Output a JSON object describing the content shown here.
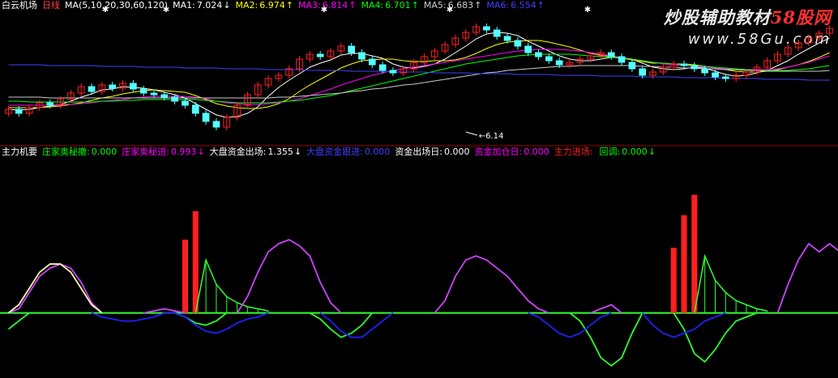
{
  "top_bar": {
    "stock_name": "白云机场",
    "period": "日线",
    "ma_params": "MA(5,10,20,30,60,120)",
    "items": [
      {
        "label": "MA1:",
        "value": "7.024",
        "arrow": "↓",
        "color": "#ffffff"
      },
      {
        "label": "MA2:",
        "value": "6.974",
        "arrow": "↑",
        "color": "#ffff00"
      },
      {
        "label": "MA3:",
        "value": "6.814",
        "arrow": "↑",
        "color": "#ff00ff"
      },
      {
        "label": "MA4:",
        "value": "6.701",
        "arrow": "↑",
        "color": "#00ff00"
      },
      {
        "label": "MA5:",
        "value": "6.683",
        "arrow": "↑",
        "color": "#cccccc"
      },
      {
        "label": "MA6:",
        "value": "6.554",
        "arrow": "↑",
        "color": "#4040ff"
      }
    ]
  },
  "watermark": {
    "line1_main": "炒股辅助教材",
    "line1_accent": "58股网",
    "line2": "www.58Gu.com"
  },
  "low_annotation": "6.14",
  "indicator_bar": {
    "title": "主力机要",
    "items": [
      {
        "label": "庄家奥秘撤:",
        "value": "0.000",
        "arrow": "",
        "color": "#00ff00"
      },
      {
        "label": "庄家奥秘进:",
        "value": "0.993",
        "arrow": "↓",
        "color": "#ff00ff"
      },
      {
        "label": "大盘资金出场:",
        "value": "1.355",
        "arrow": "↓",
        "color": "#ffffff"
      },
      {
        "label": "大盘资金跟进:",
        "value": "0.000",
        "arrow": "",
        "color": "#4040ff"
      },
      {
        "label": "资金出场日:",
        "value": "0.000",
        "arrow": "",
        "color": "#ffffff"
      },
      {
        "label": "资金加仓日:",
        "value": "0.000",
        "arrow": "",
        "color": "#ff00ff"
      },
      {
        "label": "主力进场:",
        "value": "",
        "arrow": "",
        "color": "#ff2020"
      },
      {
        "label": "回调:",
        "value": "0.000",
        "arrow": "↓",
        "color": "#00ff00"
      }
    ]
  },
  "chart_data": [
    {
      "type": "candlestick",
      "panel": "price",
      "up_color": "#ff2020",
      "down_color": "#54ffff",
      "low_marker": {
        "index": 44,
        "value": 6.14
      },
      "closes": [
        6.4,
        6.35,
        6.42,
        6.48,
        6.45,
        6.52,
        6.6,
        6.68,
        6.62,
        6.7,
        6.66,
        6.72,
        6.65,
        6.6,
        6.58,
        6.55,
        6.5,
        6.45,
        6.35,
        6.25,
        6.18,
        6.3,
        6.45,
        6.58,
        6.7,
        6.78,
        6.82,
        6.9,
        7.02,
        7.08,
        7.05,
        7.12,
        7.18,
        7.1,
        7.02,
        6.95,
        6.88,
        6.85,
        6.9,
        6.98,
        7.05,
        7.12,
        7.2,
        7.28,
        7.35,
        7.42,
        7.38,
        7.3,
        7.25,
        7.18,
        7.1,
        7.05,
        7.0,
        6.95,
        6.98,
        7.02,
        7.06,
        7.1,
        7.05,
        6.98,
        6.9,
        6.82,
        6.86,
        6.92,
        6.96,
        6.94,
        6.9,
        6.85,
        6.8,
        6.78,
        6.82,
        6.86,
        6.92,
        7.0,
        7.08,
        7.16,
        7.22,
        7.28,
        7.34,
        7.4
      ],
      "ma_lines": [
        {
          "name": "MA1",
          "color": "#ffffff",
          "values": [
            6.4,
            6.39,
            6.4,
            6.42,
            6.44,
            6.46,
            6.5,
            6.55,
            6.59,
            6.64,
            6.65,
            6.68,
            6.67,
            6.66,
            6.64,
            6.61,
            6.58,
            6.54,
            6.47,
            6.4,
            6.33,
            6.3,
            6.31,
            6.35,
            6.43,
            6.56,
            6.67,
            6.76,
            6.84,
            6.92,
            6.97,
            7.01,
            7.07,
            7.09,
            7.09,
            7.06,
            7.03,
            6.96,
            6.92,
            6.91,
            6.93,
            6.96,
            7.02,
            7.1,
            7.18,
            7.27,
            7.33,
            7.35,
            7.34,
            7.31,
            7.24,
            7.18,
            7.12,
            7.06,
            7.02,
            7.0,
            7.0,
            7.02,
            7.04,
            7.04,
            7.02,
            6.97,
            6.92,
            6.9,
            6.89,
            6.9,
            6.92,
            6.91,
            6.87,
            6.83,
            6.81,
            6.82,
            6.85,
            6.88,
            6.94,
            7.0,
            7.08,
            7.15,
            7.22,
            7.28
          ]
        },
        {
          "name": "MA2",
          "color": "#ffff00",
          "values": [
            6.42,
            6.42,
            6.42,
            6.42,
            6.43,
            6.44,
            6.46,
            6.48,
            6.51,
            6.54,
            6.56,
            6.59,
            6.61,
            6.63,
            6.64,
            6.63,
            6.62,
            6.61,
            6.57,
            6.52,
            6.47,
            6.44,
            6.42,
            6.41,
            6.41,
            6.43,
            6.47,
            6.53,
            6.62,
            6.7,
            6.77,
            6.84,
            6.91,
            6.96,
            7.0,
            7.01,
            7.02,
            7.02,
            7.0,
            6.99,
            6.99,
            7.0,
            7.0,
            7.01,
            7.04,
            7.09,
            7.15,
            7.2,
            7.23,
            7.24,
            7.25,
            7.25,
            7.23,
            7.2,
            7.17,
            7.13,
            7.09,
            7.07,
            7.05,
            7.03,
            7.01,
            6.99,
            6.97,
            6.97,
            6.96,
            6.96,
            6.95,
            6.93,
            6.91,
            6.89,
            6.87,
            6.86,
            6.86,
            6.87,
            6.89,
            6.92,
            6.95,
            6.99,
            7.04,
            7.1
          ]
        },
        {
          "name": "MA3",
          "color": "#ff00ff",
          "values": [
            6.45,
            6.45,
            6.45,
            6.45,
            6.45,
            6.46,
            6.46,
            6.47,
            6.48,
            6.5,
            6.51,
            6.52,
            6.54,
            6.55,
            6.56,
            6.56,
            6.56,
            6.56,
            6.55,
            6.53,
            6.5,
            6.48,
            6.47,
            6.46,
            6.46,
            6.47,
            6.48,
            6.5,
            6.53,
            6.57,
            6.61,
            6.65,
            6.7,
            6.74,
            6.78,
            6.82,
            6.85,
            6.88,
            6.9,
            6.92,
            6.94,
            6.96,
            6.98,
            7.0,
            7.02,
            7.04,
            7.06,
            7.08,
            7.1,
            7.12,
            7.13,
            7.14,
            7.14,
            7.14,
            7.13,
            7.12,
            7.1,
            7.08,
            7.06,
            7.04,
            7.02,
            7.0,
            6.98,
            6.96,
            6.95,
            6.94,
            6.93,
            6.92,
            6.91,
            6.9,
            6.89,
            6.89,
            6.89,
            6.89,
            6.9,
            6.92,
            6.95,
            6.98,
            7.02,
            7.06
          ]
        },
        {
          "name": "MA4",
          "color": "#00ff00",
          "values": [
            6.5,
            6.5,
            6.49,
            6.49,
            6.49,
            6.49,
            6.49,
            6.49,
            6.49,
            6.5,
            6.5,
            6.51,
            6.51,
            6.52,
            6.52,
            6.52,
            6.52,
            6.52,
            6.52,
            6.51,
            6.5,
            6.49,
            6.48,
            6.48,
            6.48,
            6.48,
            6.49,
            6.5,
            6.51,
            6.53,
            6.55,
            6.57,
            6.6,
            6.63,
            6.66,
            6.69,
            6.72,
            6.75,
            6.78,
            6.81,
            6.84,
            6.87,
            6.9,
            6.93,
            6.96,
            6.98,
            7.0,
            7.02,
            7.04,
            7.06,
            7.07,
            7.08,
            7.08,
            7.08,
            7.08,
            7.07,
            7.06,
            7.05,
            7.04,
            7.03,
            7.02,
            7.0,
            6.98,
            6.97,
            6.96,
            6.95,
            6.94,
            6.93,
            6.92,
            6.91,
            6.9,
            6.89,
            6.88,
            6.88,
            6.88,
            6.88,
            6.89,
            6.9,
            6.92,
            6.94
          ]
        },
        {
          "name": "MA5",
          "color": "#cccccc",
          "values": [
            6.55,
            6.55,
            6.55,
            6.55,
            6.54,
            6.54,
            6.54,
            6.54,
            6.54,
            6.54,
            6.54,
            6.54,
            6.54,
            6.54,
            6.54,
            6.54,
            6.54,
            6.54,
            6.54,
            6.54,
            6.54,
            6.54,
            6.54,
            6.54,
            6.54,
            6.54,
            6.55,
            6.55,
            6.56,
            6.57,
            6.58,
            6.59,
            6.6,
            6.62,
            6.63,
            6.65,
            6.66,
            6.68,
            6.7,
            6.71,
            6.73,
            6.75,
            6.77,
            6.79,
            6.81,
            6.83,
            6.85,
            6.86,
            6.88,
            6.89,
            6.9,
            6.91,
            6.92,
            6.93,
            6.93,
            6.94,
            6.94,
            6.94,
            6.94,
            6.94,
            6.94,
            6.93,
            6.93,
            6.92,
            6.92,
            6.91,
            6.91,
            6.9,
            6.9,
            6.89,
            6.89,
            6.88,
            6.88,
            6.87,
            6.87,
            6.87,
            6.87,
            6.87,
            6.87,
            6.88
          ]
        },
        {
          "name": "MA6",
          "color": "#4040ff",
          "values": [
            6.95,
            6.95,
            6.95,
            6.95,
            6.94,
            6.94,
            6.94,
            6.94,
            6.94,
            6.93,
            6.93,
            6.93,
            6.93,
            6.92,
            6.92,
            6.92,
            6.92,
            6.91,
            6.91,
            6.91,
            6.91,
            6.9,
            6.9,
            6.9,
            6.9,
            6.89,
            6.89,
            6.89,
            6.89,
            6.88,
            6.88,
            6.88,
            6.88,
            6.87,
            6.87,
            6.87,
            6.87,
            6.86,
            6.86,
            6.86,
            6.86,
            6.85,
            6.85,
            6.85,
            6.85,
            6.84,
            6.84,
            6.84,
            6.84,
            6.83,
            6.83,
            6.83,
            6.83,
            6.82,
            6.82,
            6.82,
            6.82,
            6.81,
            6.81,
            6.81,
            6.81,
            6.8,
            6.8,
            6.8,
            6.8,
            6.79,
            6.79,
            6.79,
            6.79,
            6.78,
            6.78,
            6.78,
            6.78,
            6.77,
            6.77,
            6.77,
            6.77,
            6.76,
            6.76,
            6.76
          ]
        }
      ]
    },
    {
      "type": "line",
      "panel": "indicator",
      "baseline": 0,
      "ylim": [
        -30,
        75
      ],
      "series": [
        {
          "name": "庄家奥秘进",
          "color": "#cc44ff",
          "values": [
            0,
            2,
            10,
            18,
            22,
            24,
            22,
            15,
            5,
            0,
            0,
            0,
            0,
            0,
            1,
            2,
            1,
            0,
            0,
            0,
            0,
            0,
            0,
            8,
            20,
            30,
            34,
            36,
            33,
            28,
            15,
            5,
            0,
            0,
            0,
            0,
            0,
            0,
            0,
            0,
            0,
            0,
            6,
            18,
            26,
            28,
            26,
            22,
            18,
            12,
            6,
            2,
            0,
            0,
            0,
            0,
            0,
            2,
            4,
            0,
            0,
            0,
            0,
            0,
            0,
            0,
            0,
            0,
            0,
            0,
            0,
            0,
            0,
            0,
            0,
            14,
            26,
            34,
            30,
            34,
            30,
            24
          ]
        },
        {
          "name": "大盘资金出场",
          "color": "#ffffaa",
          "values": [
            0,
            4,
            12,
            20,
            24,
            24,
            20,
            12,
            4,
            0,
            0,
            0,
            0,
            0,
            0,
            0,
            0,
            0,
            0,
            0,
            0,
            0,
            0,
            0,
            0,
            0,
            0,
            0,
            0,
            0,
            0,
            0,
            0,
            0,
            0,
            0,
            0,
            0,
            0,
            0,
            0,
            0,
            0,
            0,
            0,
            0,
            0,
            0,
            0,
            0,
            0,
            0,
            0,
            0,
            0,
            0,
            0,
            0,
            0,
            0,
            0,
            0,
            0,
            0,
            0,
            0,
            0,
            0,
            0,
            0,
            0,
            0,
            0,
            0,
            0,
            0,
            0,
            0,
            0,
            0,
            0,
            0
          ]
        },
        {
          "name": "回调",
          "color": "#30ff30",
          "values": [
            -8,
            -4,
            0,
            0,
            0,
            0,
            0,
            0,
            0,
            0,
            0,
            0,
            0,
            0,
            0,
            0,
            0,
            -2,
            -5,
            -6,
            -4,
            0,
            0,
            0,
            0,
            0,
            0,
            0,
            0,
            0,
            -3,
            -8,
            -12,
            -10,
            -6,
            0,
            0,
            0,
            0,
            0,
            0,
            0,
            0,
            0,
            0,
            0,
            0,
            0,
            0,
            0,
            0,
            0,
            0,
            0,
            0,
            -4,
            -12,
            -22,
            -26,
            -22,
            -10,
            0,
            0,
            0,
            0,
            -8,
            -20,
            -24,
            -18,
            -10,
            -4,
            -2,
            0,
            0,
            0,
            0,
            0,
            0,
            0,
            0
          ]
        },
        {
          "name": "大盘资金跟进",
          "color": "#2020ff",
          "values": [
            0,
            0,
            0,
            0,
            0,
            0,
            0,
            0,
            0,
            -2,
            -3,
            -4,
            -4,
            -3,
            -2,
            0,
            0,
            -2,
            -6,
            -9,
            -10,
            -8,
            -5,
            -3,
            -2,
            0,
            0,
            0,
            0,
            0,
            0,
            -4,
            -9,
            -12,
            -12,
            -8,
            -4,
            0,
            0,
            0,
            0,
            0,
            0,
            0,
            0,
            0,
            0,
            0,
            0,
            0,
            0,
            -2,
            -6,
            -10,
            -12,
            -10,
            -6,
            -2,
            0,
            0,
            0,
            0,
            -6,
            -10,
            -12,
            -10,
            -8,
            -4,
            -2,
            0,
            0,
            0,
            0,
            0,
            0,
            0,
            0,
            0,
            0,
            0,
            0,
            0
          ]
        }
      ],
      "bars": {
        "name": "主力进场",
        "color": "#ff2020",
        "items": [
          {
            "index": 17,
            "value": 36
          },
          {
            "index": 18,
            "value": 50
          },
          {
            "index": 64,
            "value": 32
          },
          {
            "index": 65,
            "value": 48
          },
          {
            "index": 66,
            "value": 58
          }
        ]
      },
      "spike_series": {
        "name": "庄家奥秘撤",
        "color": "#30ff30",
        "spikes": [
          {
            "start": 19,
            "peak": 26,
            "decay": [
              26,
              14,
              8,
              5,
              3,
              2,
              1
            ]
          },
          {
            "start": 67,
            "peak": 28,
            "decay": [
              28,
              16,
              10,
              6,
              4,
              2,
              1
            ]
          }
        ]
      }
    }
  ]
}
